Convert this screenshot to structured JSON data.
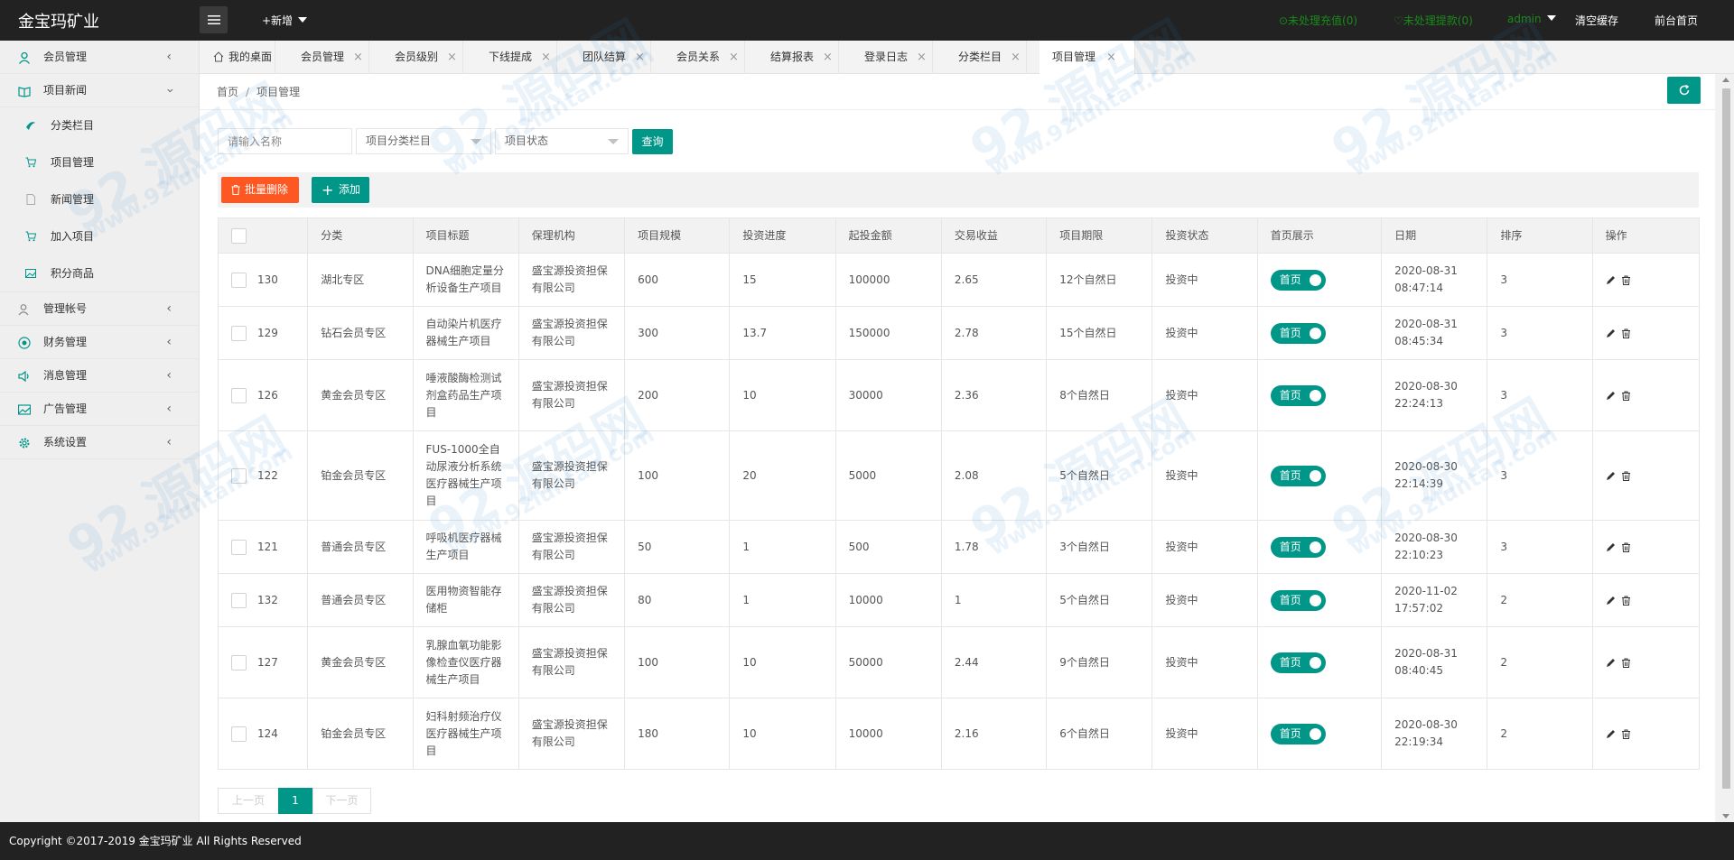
{
  "header": {
    "logo": "金宝玛矿业",
    "add_new": "+新增",
    "pending_recharge": "⊙未处理充值(0)",
    "pending_withdraw": "♡未处理提款(0)",
    "user": "admin",
    "clear_cache": "清空缓存",
    "front_home": "前台首页"
  },
  "sidebar": {
    "items": [
      {
        "label": "会员管理",
        "icon": "user-icon"
      },
      {
        "label": "项目新闻",
        "icon": "book-icon"
      },
      {
        "label": "分类栏目",
        "icon": "leaf-icon"
      },
      {
        "label": "项目管理",
        "icon": "cart-icon"
      },
      {
        "label": "新闻管理",
        "icon": "doc-icon"
      },
      {
        "label": "加入项目",
        "icon": "cart-icon"
      },
      {
        "label": "积分商品",
        "icon": "image-icon"
      },
      {
        "label": "管理帐号",
        "icon": "users-icon"
      },
      {
        "label": "财务管理",
        "icon": "coin-icon"
      },
      {
        "label": "消息管理",
        "icon": "speaker-icon"
      },
      {
        "label": "广告管理",
        "icon": "picture-icon"
      },
      {
        "label": "系统设置",
        "icon": "gear-icon"
      }
    ]
  },
  "tabs": [
    "我的桌面",
    "会员管理",
    "会员级别",
    "下线提成",
    "团队结算",
    "会员关系",
    "结算报表",
    "登录日志",
    "分类栏目",
    "项目管理"
  ],
  "breadcrumb": {
    "home": "首页",
    "current": "项目管理"
  },
  "search": {
    "placeholder": "请输入名称",
    "category_select": "项目分类栏目",
    "status_select": "项目状态",
    "query_button": "查询"
  },
  "toolbar": {
    "batch_delete": "批量删除",
    "add": "添加"
  },
  "table": {
    "headers": [
      "分类",
      "项目标题",
      "保理机构",
      "项目规模",
      "投资进度",
      "起投金额",
      "交易收益",
      "项目期限",
      "投资状态",
      "首页展示",
      "日期",
      "排序",
      "操作"
    ],
    "rows": [
      {
        "id": "130",
        "category": "湖北专区",
        "title": "DNA细胞定量分析设备生产项目",
        "agency": "盛宝源投资担保有限公司",
        "scale": "600",
        "progress": "15",
        "min_invest": "100000",
        "yield": "2.65",
        "term": "12个自然日",
        "status": "投资中",
        "home_show": "首页",
        "date": "2020-08-31 08:47:14",
        "sort": "3"
      },
      {
        "id": "129",
        "category": "钻石会员专区",
        "title": "自动染片机医疗器械生产项目",
        "agency": "盛宝源投资担保有限公司",
        "scale": "300",
        "progress": "13.7",
        "min_invest": "150000",
        "yield": "2.78",
        "term": "15个自然日",
        "status": "投资中",
        "home_show": "首页",
        "date": "2020-08-31 08:45:34",
        "sort": "3"
      },
      {
        "id": "126",
        "category": "黄金会员专区",
        "title": "唾液酸酶检测试剂盒药品生产项目",
        "agency": "盛宝源投资担保有限公司",
        "scale": "200",
        "progress": "10",
        "min_invest": "30000",
        "yield": "2.36",
        "term": "8个自然日",
        "status": "投资中",
        "home_show": "首页",
        "date": "2020-08-30 22:24:13",
        "sort": "3"
      },
      {
        "id": "122",
        "category": "铂金会员专区",
        "title": "FUS-1000全自动尿液分析系统医疗器械生产项目",
        "agency": "盛宝源投资担保有限公司",
        "scale": "100",
        "progress": "20",
        "min_invest": "5000",
        "yield": "2.08",
        "term": "5个自然日",
        "status": "投资中",
        "home_show": "首页",
        "date": "2020-08-30 22:14:39",
        "sort": "3"
      },
      {
        "id": "121",
        "category": "普通会员专区",
        "title": "呼吸机医疗器械生产项目",
        "agency": "盛宝源投资担保有限公司",
        "scale": "50",
        "progress": "1",
        "min_invest": "500",
        "yield": "1.78",
        "term": "3个自然日",
        "status": "投资中",
        "home_show": "首页",
        "date": "2020-08-30 22:10:23",
        "sort": "3"
      },
      {
        "id": "132",
        "category": "普通会员专区",
        "title": "医用物资智能存储柜",
        "agency": "盛宝源投资担保有限公司",
        "scale": "80",
        "progress": "1",
        "min_invest": "10000",
        "yield": "1",
        "term": "5个自然日",
        "status": "投资中",
        "home_show": "首页",
        "date": "2020-11-02 17:57:02",
        "sort": "2"
      },
      {
        "id": "127",
        "category": "黄金会员专区",
        "title": "乳腺血氧功能影像检查仪医疗器械生产项目",
        "agency": "盛宝源投资担保有限公司",
        "scale": "100",
        "progress": "10",
        "min_invest": "50000",
        "yield": "2.44",
        "term": "9个自然日",
        "status": "投资中",
        "home_show": "首页",
        "date": "2020-08-31 08:40:45",
        "sort": "2"
      },
      {
        "id": "124",
        "category": "铂金会员专区",
        "title": "妇科射频治疗仪医疗器械生产项目",
        "agency": "盛宝源投资担保有限公司",
        "scale": "180",
        "progress": "10",
        "min_invest": "10000",
        "yield": "2.16",
        "term": "6个自然日",
        "status": "投资中",
        "home_show": "首页",
        "date": "2020-08-30 22:19:34",
        "sort": "2"
      }
    ]
  },
  "pager": {
    "prev": "上一页",
    "current": "1",
    "next": "下一页"
  },
  "footer": {
    "copyright": "Copyright ©2017-2019 金宝玛矿业 All Rights Reserved"
  },
  "watermark": {
    "logo_text": "92 源码网",
    "url": "www.92luntan.com"
  },
  "colors": {
    "primary": "#009688",
    "danger": "#ff5722",
    "header_bg": "#222222",
    "pending_green": "#1a8a1a"
  }
}
